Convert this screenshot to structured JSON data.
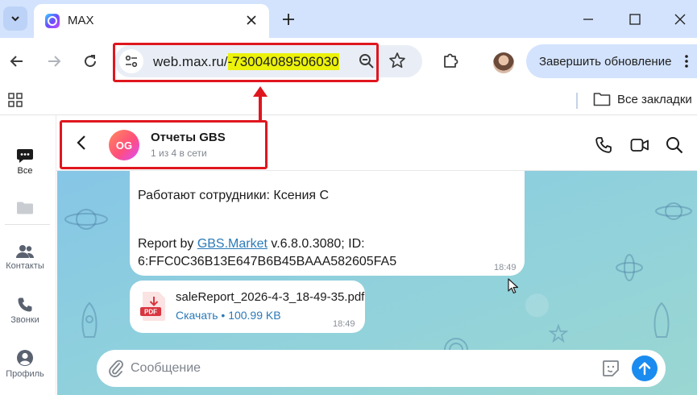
{
  "browser": {
    "tab": {
      "title": "MAX"
    },
    "address": {
      "url_prefix": "web.max.ru/",
      "url_highlight": "-73004089506030"
    },
    "update_button": {
      "label": "Завершить обновление"
    },
    "bookmarks": {
      "all_label": "Все закладки"
    }
  },
  "sidebar": {
    "items": [
      {
        "label": "Все",
        "icon": "chat-icon"
      },
      {
        "label": "",
        "icon": "folder-icon"
      },
      {
        "label": "Контакты",
        "icon": "contacts-icon"
      },
      {
        "label": "Звонки",
        "icon": "phone-icon"
      },
      {
        "label": "Профиль",
        "icon": "profile-icon"
      }
    ]
  },
  "chat": {
    "avatar_initials": "OG",
    "title": "Отчеты GBS",
    "subtitle": "1 из 4 в сети"
  },
  "messages": {
    "text_msg": {
      "line1": "Работают сотрудники: Ксения С",
      "report_prefix": "Report by ",
      "report_link": "GBS.Market",
      "report_suffix": " v.6.8.0.3080; ID:",
      "id_line": "6:FFC0C36B13E647B6B45BAAA582605FA5",
      "time": "18:49"
    },
    "file_msg": {
      "file_name": "saleReport_2026-4-3_18-49-35.pdf",
      "file_type": "PDF",
      "download_label": "Скачать",
      "file_size": "100.99 KB",
      "time": "18:49"
    }
  },
  "composer": {
    "placeholder": "Сообщение"
  },
  "colors": {
    "accent": "#1a8cf0",
    "annotation": "#e0161e",
    "url_highlight": "#ecf20a"
  }
}
